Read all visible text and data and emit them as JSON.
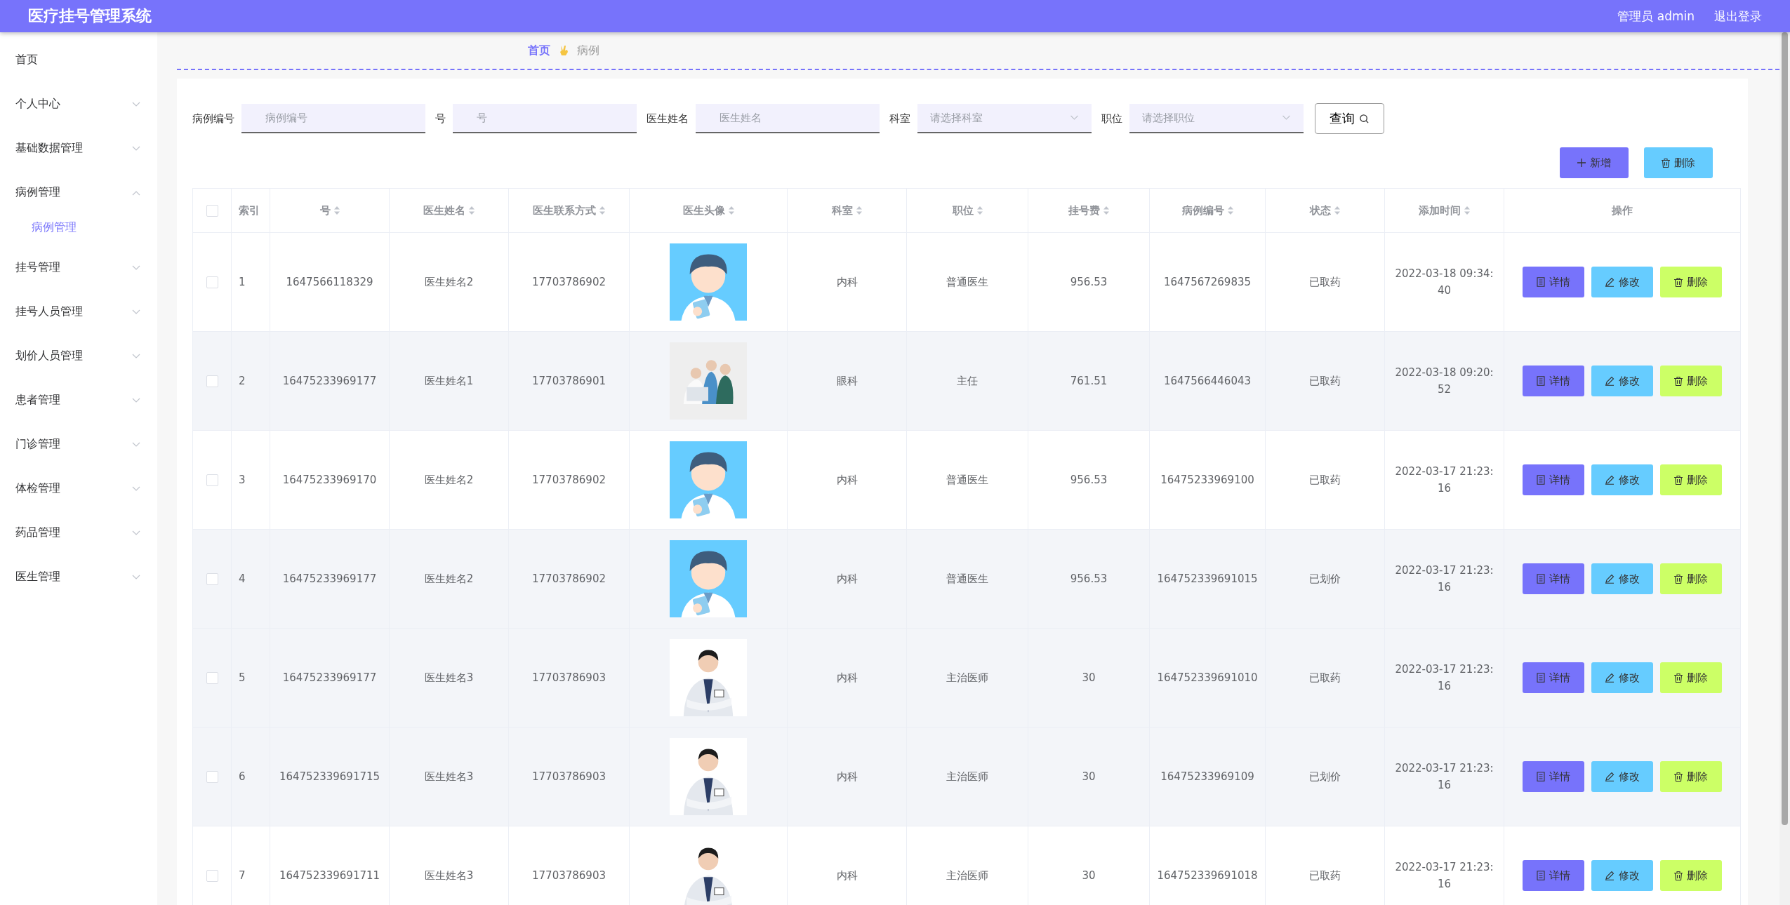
{
  "header": {
    "title": "医疗挂号管理系统",
    "user": "管理员 admin",
    "logout": "退出登录"
  },
  "sidebar": {
    "items": [
      {
        "label": "首页",
        "kind": "link",
        "selected": false
      },
      {
        "label": "个人中心",
        "kind": "menu",
        "expanded": false,
        "selected": false
      },
      {
        "label": "基础数据管理",
        "kind": "menu",
        "expanded": false,
        "selected": false
      },
      {
        "label": "病例管理",
        "kind": "menu",
        "expanded": true,
        "selected": false,
        "children": [
          {
            "label": "病例管理",
            "selected": true
          }
        ]
      },
      {
        "label": "挂号管理",
        "kind": "menu",
        "expanded": false,
        "selected": false
      },
      {
        "label": "挂号人员管理",
        "kind": "menu",
        "expanded": false,
        "selected": false
      },
      {
        "label": "划价人员管理",
        "kind": "menu",
        "expanded": false,
        "selected": false
      },
      {
        "label": "患者管理",
        "kind": "menu",
        "expanded": false,
        "selected": false
      },
      {
        "label": "门诊管理",
        "kind": "menu",
        "expanded": false,
        "selected": false
      },
      {
        "label": "体检管理",
        "kind": "menu",
        "expanded": false,
        "selected": false
      },
      {
        "label": "药品管理",
        "kind": "menu",
        "expanded": false,
        "selected": false
      },
      {
        "label": "医生管理",
        "kind": "menu",
        "expanded": false,
        "selected": false
      }
    ]
  },
  "breadcrumb": [
    "首页",
    "病例"
  ],
  "filters": [
    {
      "label": "病例编号",
      "kind": "text",
      "placeholder": "病例编号"
    },
    {
      "label": "号",
      "kind": "text",
      "placeholder": "号"
    },
    {
      "label": "医生姓名",
      "kind": "text",
      "placeholder": "医生姓名"
    },
    {
      "label": "科室",
      "kind": "select",
      "placeholder": "请选择科室"
    },
    {
      "label": "职位",
      "kind": "select",
      "placeholder": "请选择职位"
    }
  ],
  "search_button": "查询",
  "toolbar": [
    {
      "kind": "add",
      "label": "新增"
    },
    {
      "kind": "delete",
      "label": "删除"
    }
  ],
  "table": {
    "select_all": {
      "checked": false
    },
    "columns": [
      {
        "label": "索引",
        "sortable": false
      },
      {
        "label": "号",
        "sortable": true
      },
      {
        "label": "医生姓名",
        "sortable": true
      },
      {
        "label": "医生联系方式",
        "sortable": true
      },
      {
        "label": "医生头像",
        "sortable": true
      },
      {
        "label": "科室",
        "sortable": true
      },
      {
        "label": "职位",
        "sortable": true
      },
      {
        "label": "挂号费",
        "sortable": true
      },
      {
        "label": "病例编号",
        "sortable": true
      },
      {
        "label": "状态",
        "sortable": true
      },
      {
        "label": "添加时间",
        "sortable": true
      },
      {
        "label": "操作",
        "sortable": false
      }
    ],
    "rows": [
      {
        "checked": false,
        "shaded": false,
        "cells": [
          "1",
          "1647566118329",
          "医生姓名2",
          "17703786902",
          {
            "kind": "picture"
          },
          "内科",
          "普通医生",
          "956.53",
          "1647567269835",
          "已取药",
          "2022-03-18 09:34:40"
        ],
        "actions": [
          {
            "kind": "detail",
            "label": "详情"
          },
          {
            "kind": "edit",
            "label": "修改"
          },
          {
            "kind": "delete",
            "label": "删除"
          }
        ]
      },
      {
        "checked": false,
        "shaded": true,
        "cells": [
          "2",
          "16475233969177",
          "医生姓名1",
          "17703786901",
          {
            "kind": "picture"
          },
          "眼科",
          "主任",
          "761.51",
          "1647566446043",
          "已取药",
          "2022-03-18 09:20:52"
        ],
        "actions": [
          {
            "kind": "detail",
            "label": "详情"
          },
          {
            "kind": "edit",
            "label": "修改"
          },
          {
            "kind": "delete",
            "label": "删除"
          }
        ]
      },
      {
        "checked": false,
        "shaded": false,
        "cells": [
          "3",
          "16475233969170",
          "医生姓名2",
          "17703786902",
          {
            "kind": "picture"
          },
          "内科",
          "普通医生",
          "956.53",
          "16475233969100",
          "已取药",
          "2022-03-17 21:23:16"
        ],
        "actions": [
          {
            "kind": "detail",
            "label": "详情"
          },
          {
            "kind": "edit",
            "label": "修改"
          },
          {
            "kind": "delete",
            "label": "删除"
          }
        ]
      },
      {
        "checked": false,
        "shaded": true,
        "cells": [
          "4",
          "16475233969177",
          "医生姓名2",
          "17703786902",
          {
            "kind": "picture"
          },
          "内科",
          "普通医生",
          "956.53",
          "164752339691015",
          "已划价",
          "2022-03-17 21:23:16"
        ],
        "actions": [
          {
            "kind": "detail",
            "label": "详情"
          },
          {
            "kind": "edit",
            "label": "修改"
          },
          {
            "kind": "delete",
            "label": "删除"
          }
        ]
      },
      {
        "checked": false,
        "shaded": true,
        "cells": [
          "5",
          "16475233969177",
          "医生姓名3",
          "17703786903",
          {
            "kind": "picture"
          },
          "内科",
          "主治医师",
          "30",
          "164752339691010",
          "已取药",
          "2022-03-17 21:23:16"
        ],
        "actions": [
          {
            "kind": "detail",
            "label": "详情"
          },
          {
            "kind": "edit",
            "label": "修改"
          },
          {
            "kind": "delete",
            "label": "删除"
          }
        ]
      },
      {
        "checked": false,
        "shaded": true,
        "cells": [
          "6",
          "164752339691715",
          "医生姓名3",
          "17703786903",
          {
            "kind": "picture"
          },
          "内科",
          "主治医师",
          "30",
          "16475233969109",
          "已划价",
          "2022-03-17 21:23:16"
        ],
        "actions": [
          {
            "kind": "detail",
            "label": "详情"
          },
          {
            "kind": "edit",
            "label": "修改"
          },
          {
            "kind": "delete",
            "label": "删除"
          }
        ]
      },
      {
        "checked": false,
        "shaded": false,
        "cells": [
          "7",
          "164752339691711",
          "医生姓名3",
          "17703786903",
          {
            "kind": "picture"
          },
          "内科",
          "主治医师",
          "30",
          "164752339691018",
          "已取药",
          "2022-03-17 21:23:16"
        ],
        "actions": [
          {
            "kind": "detail",
            "label": "详情"
          },
          {
            "kind": "edit",
            "label": "修改"
          },
          {
            "kind": "delete",
            "label": "删除"
          }
        ]
      }
    ]
  }
}
